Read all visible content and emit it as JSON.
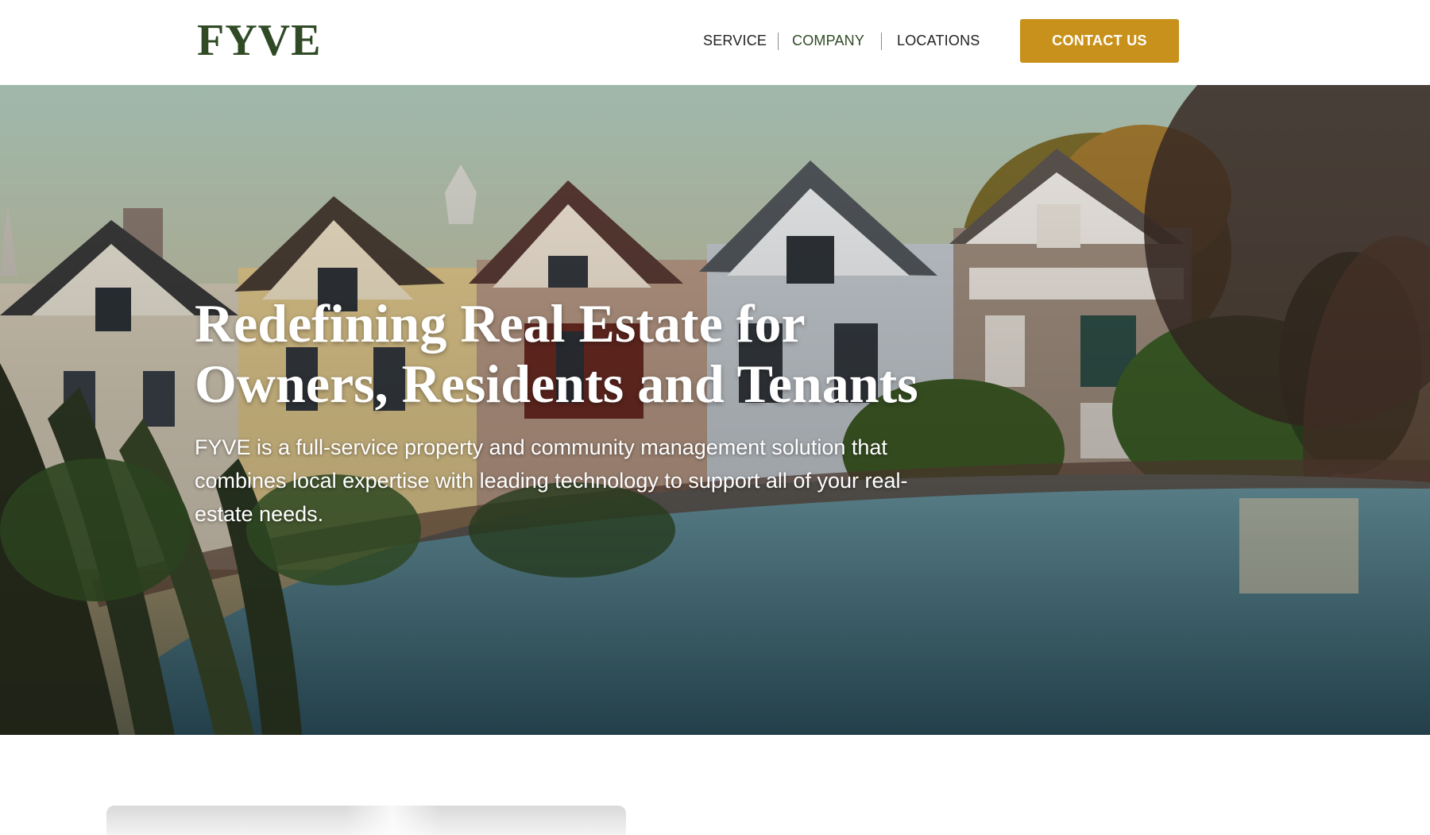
{
  "header": {
    "logo": "FYVE",
    "nav": [
      {
        "label": "SERVICE",
        "active": false
      },
      {
        "label": "COMPANY",
        "active": true
      },
      {
        "label": "LOCATIONS",
        "active": false
      }
    ],
    "cta_label": "CONTACT US"
  },
  "hero": {
    "title_line1": "Redefining Real Estate for",
    "title_line2": "Owners, Residents and Tenants",
    "subtitle": "FYVE is a full-service property and community management solution that combines local expertise with leading technology to support all of your real-estate needs."
  },
  "colors": {
    "brand_green": "#2f4a24",
    "cta_gold": "#c8911b",
    "text_dark": "#222222"
  },
  "icons": {
    "hero_image": "painted-ladies-houses-photo"
  }
}
